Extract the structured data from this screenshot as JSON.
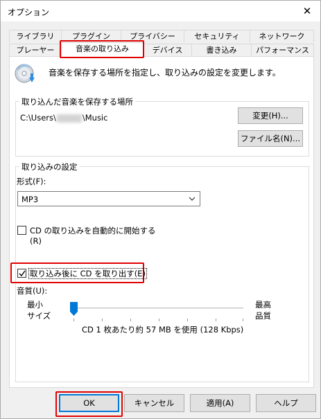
{
  "window": {
    "title": "オプション"
  },
  "tabs": {
    "row1": [
      "ライブラリ",
      "プラグイン",
      "プライバシー",
      "セキュリティ",
      "ネットワーク"
    ],
    "row2": [
      "プレーヤー",
      "音楽の取り込み",
      "デバイス",
      "書き込み",
      "パフォーマンス"
    ],
    "active": "音楽の取り込み"
  },
  "header": {
    "text": "音楽を保存する場所を指定し、取り込みの設定を変更します。",
    "icon": "cd-rip-icon"
  },
  "location_group": {
    "legend": "取り込んだ音楽を保存する場所",
    "path_prefix": "C:\\Users\\",
    "path_suffix": "\\Music",
    "change_button": "変更(H)...",
    "filename_button": "ファイル名(N)..."
  },
  "rip_settings": {
    "legend": "取り込みの設定",
    "format_label": "形式(F):",
    "format_value": "MP3",
    "auto_rip_label": "CD の取り込みを自動的に開始する",
    "auto_rip_label_key": "(R)",
    "auto_rip_checked": false,
    "eject_label": "取り込み後に CD を取り出す(E)",
    "eject_checked": true,
    "quality_label": "音質(U):",
    "quality_min_line1": "最小",
    "quality_min_line2": "サイズ",
    "quality_max_line1": "最高",
    "quality_max_line2": "品質",
    "quality_level": 0,
    "quality_info": "CD 1 枚あたり約 57 MB を使用 (128 Kbps)"
  },
  "footer": {
    "ok": "OK",
    "cancel": "キャンセル",
    "apply": "適用(A)",
    "help": "ヘルプ"
  },
  "colors": {
    "highlight": "#e00000",
    "accent": "#0078d7"
  }
}
